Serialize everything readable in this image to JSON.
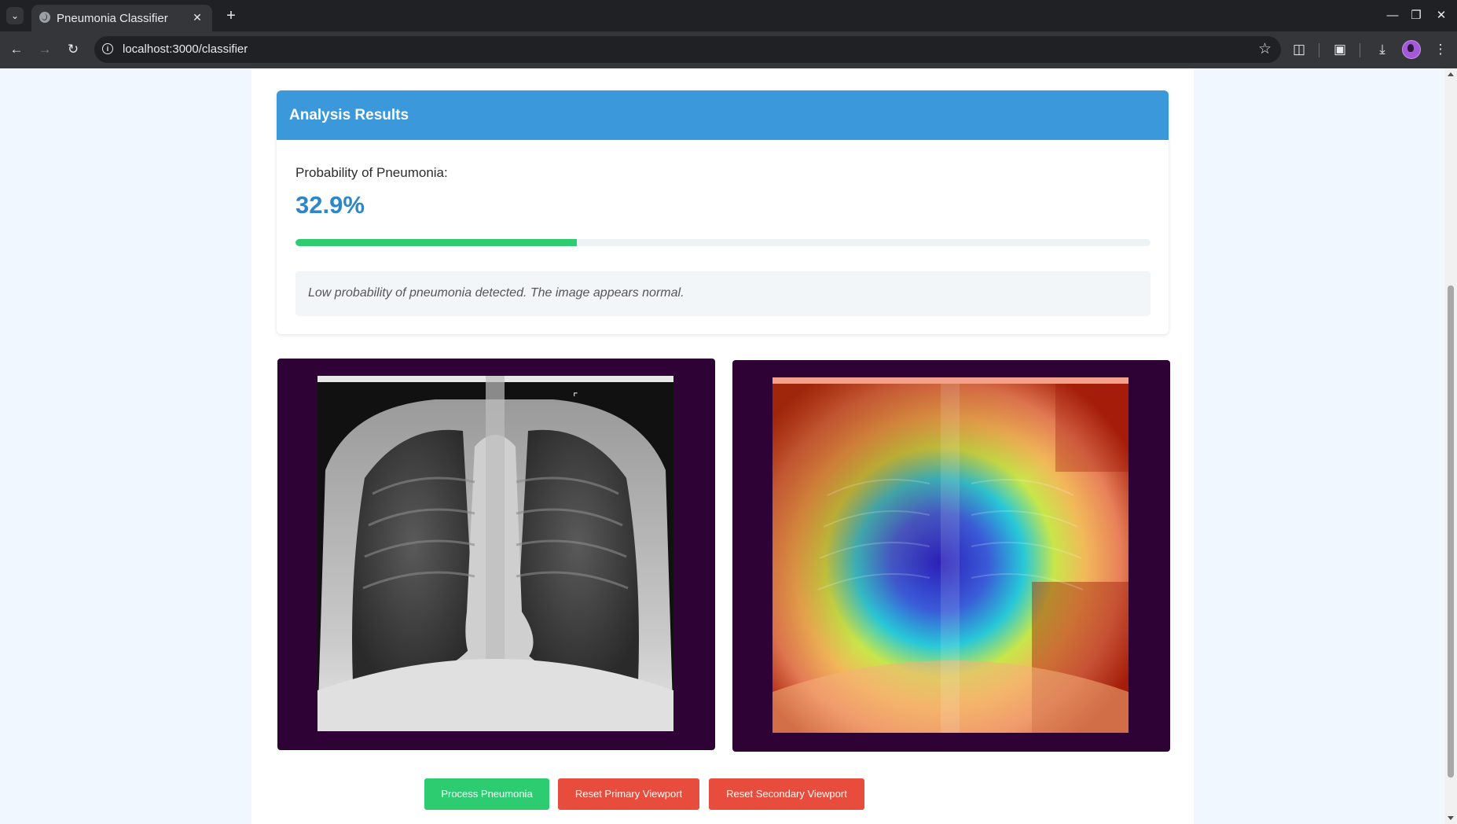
{
  "browser": {
    "tab_title": "Pneumonia Classifier",
    "url": "localhost:3000/classifier"
  },
  "results": {
    "title": "Analysis Results",
    "probability_label": "Probability of Pneumonia:",
    "probability_value": "32.9%",
    "probability_fraction": 0.329,
    "progress_color": "#2ecc71",
    "interpretation": "Low probability of pneumonia detected. The image appears normal."
  },
  "viewports": {
    "background_color": "#2f0236",
    "primary": {
      "content": "chest X-ray"
    },
    "secondary": {
      "content": "chest X-ray with heatmap overlay"
    }
  },
  "actions": {
    "process_label": "Process Pneumonia",
    "reset_primary_label": "Reset Primary Viewport",
    "reset_secondary_label": "Reset Secondary Viewport"
  },
  "colors": {
    "header_blue": "#3a98db",
    "value_blue": "#2e86c8",
    "success_green": "#2ecc71",
    "danger_red": "#e74c3c"
  }
}
